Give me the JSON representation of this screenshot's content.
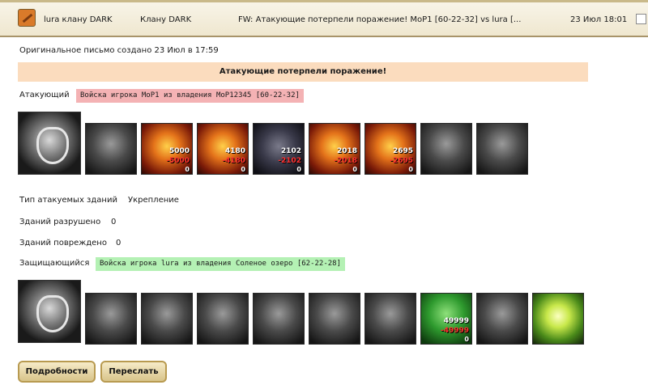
{
  "header": {
    "from": "lura клану DARK",
    "to": "Клану DARK",
    "subject": "FW: Атакующие потерпели поражение! MoP1 [60-22-32] vs lura [...",
    "date": "23 Июл 18:01",
    "icon": "sword-mail-icon"
  },
  "letter": {
    "created": "Оригинальное письмо создано 23 Июл в 17:59",
    "result": "Атакующие потерпели поражение!"
  },
  "attacker": {
    "label": "Атакующий",
    "army": "Войска игрока MoP1 из владения MoP12345 [60-22-32]",
    "units": [
      {
        "style": "gray",
        "count": "",
        "loss": "",
        "remain": ""
      },
      {
        "style": "fire",
        "count": "5000",
        "loss": "-5000",
        "remain": "0"
      },
      {
        "style": "fire",
        "count": "4180",
        "loss": "-4180",
        "remain": "0"
      },
      {
        "style": "dark",
        "count": "2102",
        "loss": "-2102",
        "remain": "0"
      },
      {
        "style": "fire",
        "count": "2018",
        "loss": "-2018",
        "remain": "0"
      },
      {
        "style": "fire",
        "count": "2695",
        "loss": "-2695",
        "remain": "0"
      },
      {
        "style": "gray",
        "count": "",
        "loss": "",
        "remain": ""
      },
      {
        "style": "gray",
        "count": "",
        "loss": "",
        "remain": ""
      }
    ]
  },
  "buildings": {
    "type_label": "Тип атакуемых зданий",
    "type_value": "Укрепление",
    "destroyed_label": "Зданий разрушено",
    "destroyed_value": "0",
    "damaged_label": "Зданий повреждено",
    "damaged_value": "0"
  },
  "defender": {
    "label": "Защищающийся",
    "army": "Войска игрока lura из владения Соленое озеро [62-22-28]",
    "units": [
      {
        "style": "gray",
        "count": "",
        "loss": "",
        "remain": ""
      },
      {
        "style": "gray",
        "count": "",
        "loss": "",
        "remain": ""
      },
      {
        "style": "gray",
        "count": "",
        "loss": "",
        "remain": ""
      },
      {
        "style": "gray",
        "count": "",
        "loss": "",
        "remain": ""
      },
      {
        "style": "gray",
        "count": "",
        "loss": "",
        "remain": ""
      },
      {
        "style": "gray",
        "count": "",
        "loss": "",
        "remain": ""
      },
      {
        "style": "green",
        "count": "49999",
        "loss": "-49999",
        "remain": "0"
      },
      {
        "style": "gray",
        "count": "",
        "loss": "",
        "remain": ""
      },
      {
        "style": "glow",
        "count": "",
        "loss": "",
        "remain": ""
      }
    ]
  },
  "buttons": {
    "details": "Подробности",
    "forward": "Переслать"
  }
}
